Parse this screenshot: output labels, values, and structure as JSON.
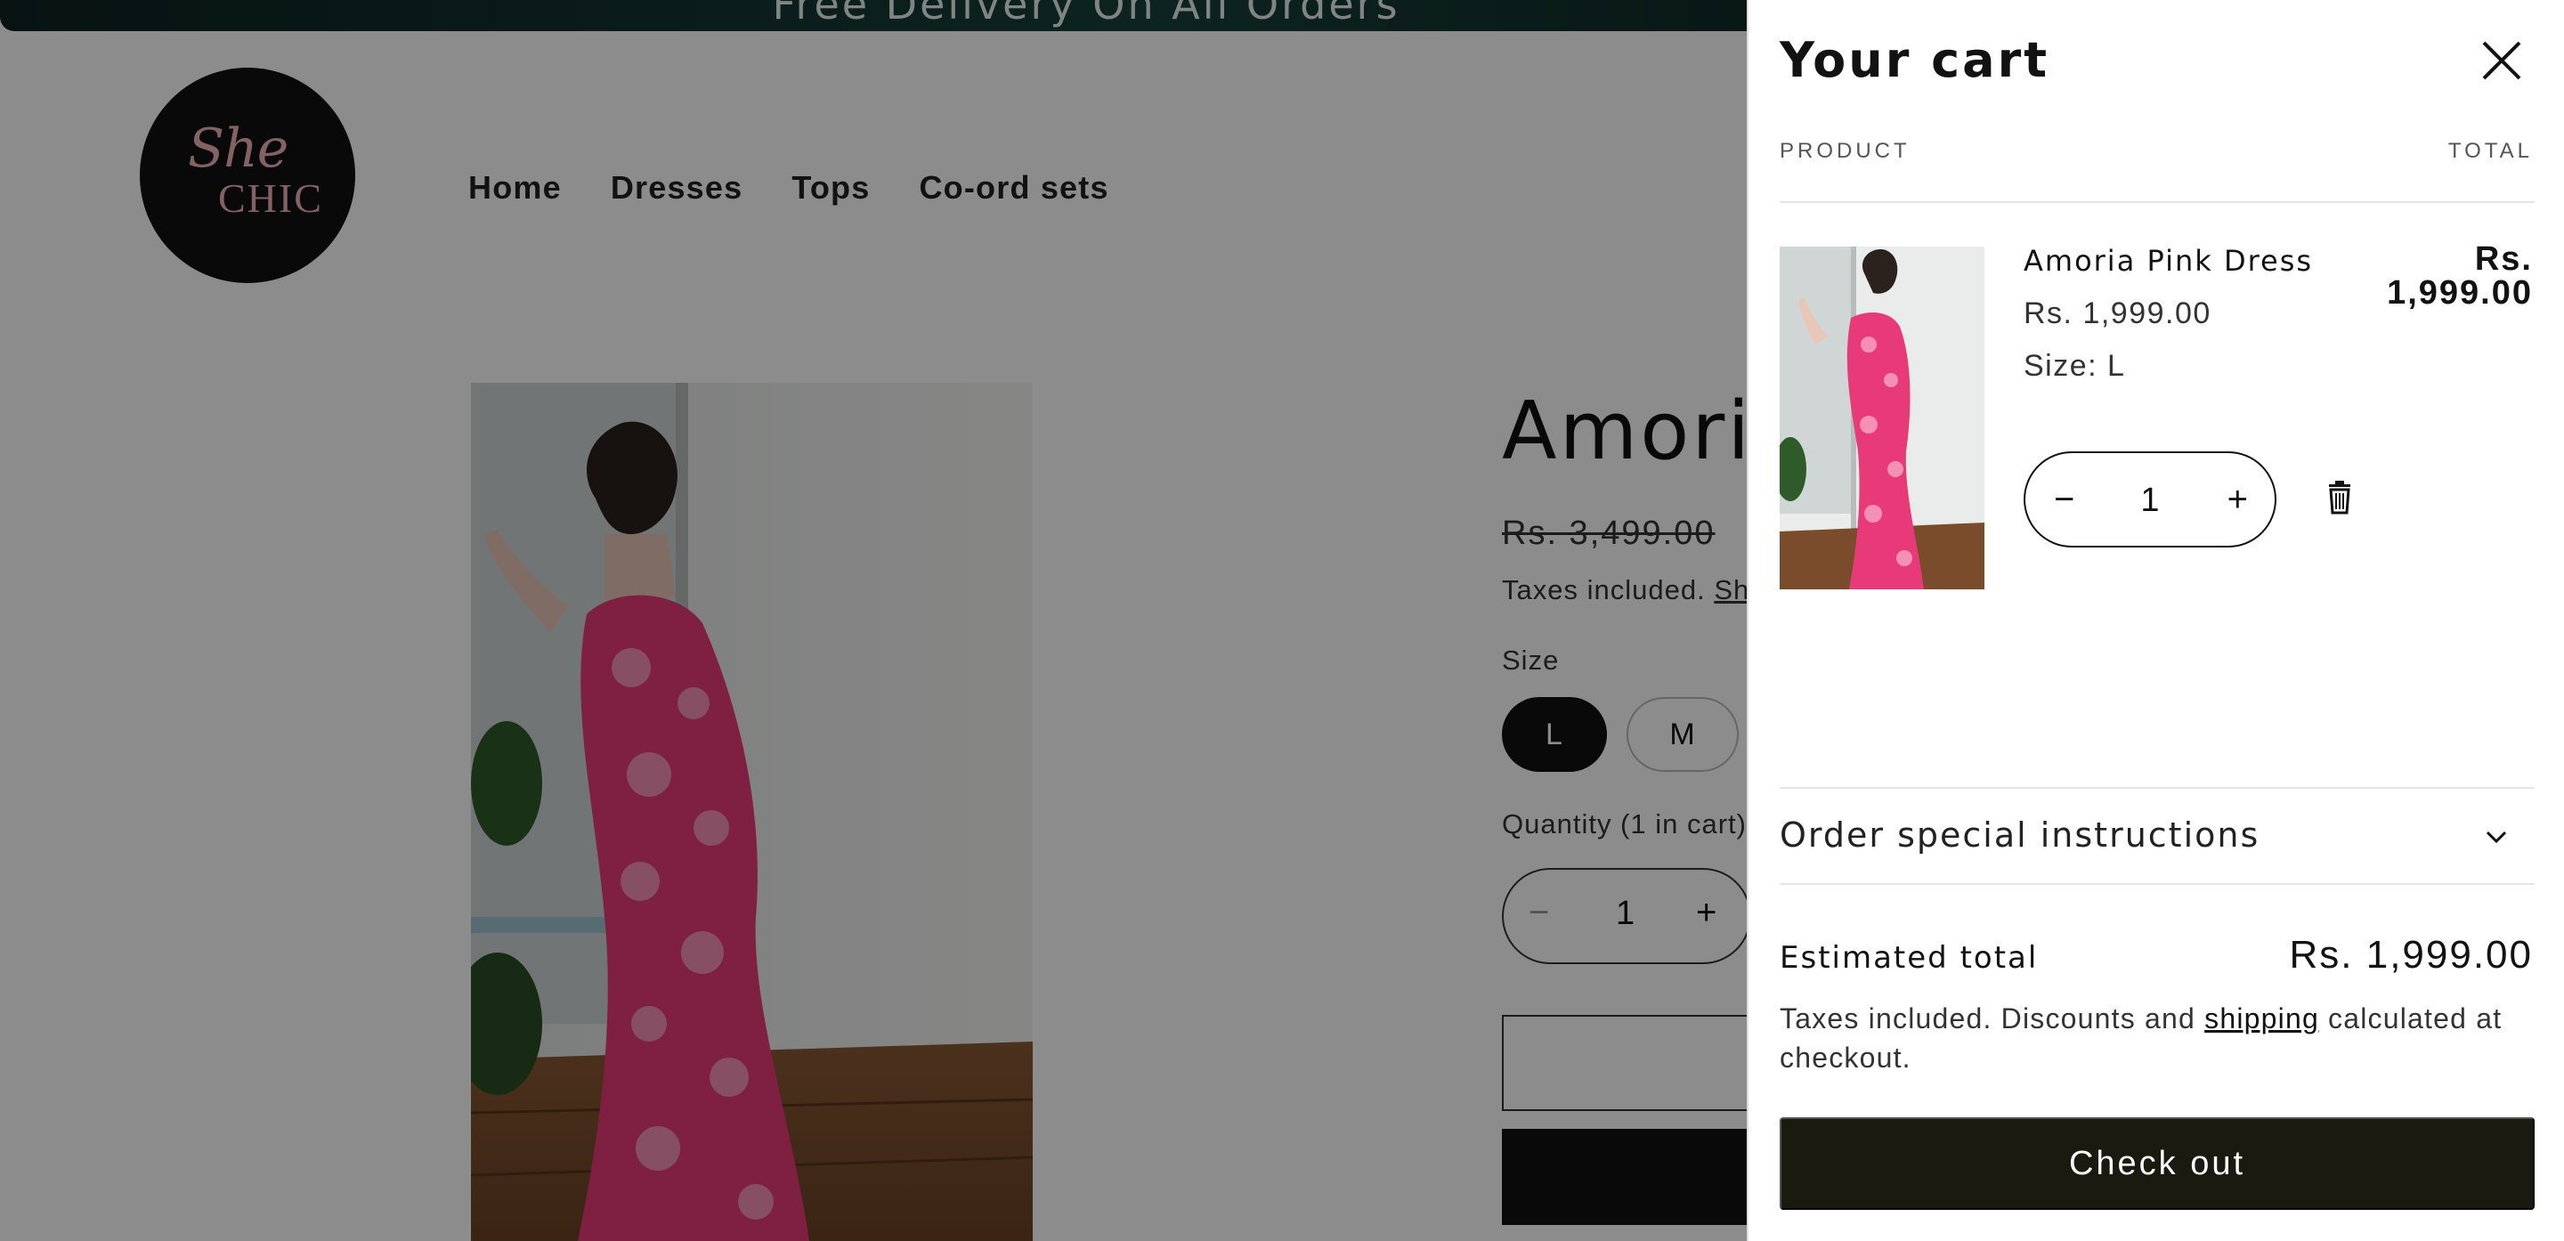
{
  "announcement": {
    "text": "Free Delivery On All Orders"
  },
  "logo": {
    "line1": "She",
    "line2": "CHIC"
  },
  "nav": {
    "items": [
      "Home",
      "Dresses",
      "Tops",
      "Co-ord sets"
    ]
  },
  "product": {
    "title": "Amoria",
    "compare_price": "Rs. 3,499.00",
    "tax_note_prefix": "Taxes included.",
    "tax_note_link": "Ship",
    "size_label": "Size",
    "sizes": [
      "L",
      "M"
    ],
    "quantity_label": "Quantity (1 in cart)",
    "quantity": "1",
    "minus": "−",
    "plus": "+"
  },
  "cart": {
    "title": "Your cart",
    "col_product": "PRODUCT",
    "col_total": "TOTAL",
    "item": {
      "name": "Amoria Pink Dress",
      "price": "Rs. 1,999.00",
      "size": "Size: L",
      "total_line1": "Rs.",
      "total_line2": "1,999.00",
      "quantity": "1",
      "minus": "−",
      "plus": "+"
    },
    "instructions_label": "Order special instructions",
    "estimated_label": "Estimated total",
    "estimated_value": "Rs. 1,999.00",
    "tax_text_before": "Taxes included. Discounts and ",
    "tax_text_link": "shipping",
    "tax_text_after": " calculated at checkout.",
    "checkout_label": "Check out"
  },
  "colors": {
    "overlay": "#000000",
    "dress_pink": "#e83a78",
    "checkout_bg": "#1b1a10",
    "logo_pink": "#f0b3b7"
  },
  "icons": [
    "close-icon",
    "trash-icon",
    "chevron-down-icon",
    "minus-icon",
    "plus-icon"
  ]
}
